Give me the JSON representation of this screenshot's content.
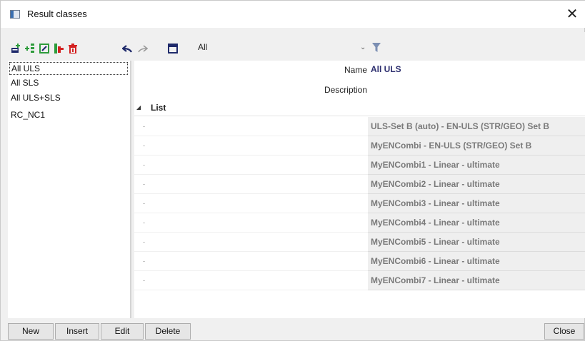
{
  "window": {
    "title": "Result classes"
  },
  "toolbar": {
    "icons": [
      "new-class-icon",
      "insert-class-icon",
      "edit-class-icon",
      "copy-class-icon",
      "delete-class-icon",
      "undo-icon",
      "redo-icon",
      "window-icon"
    ],
    "filter_value": "All"
  },
  "result_classes": [
    "All ULS",
    "All SLS",
    "All ULS+SLS",
    "RC_NC1"
  ],
  "properties": {
    "name_label": "Name",
    "name_value": "All ULS",
    "description_label": "Description",
    "description_value": "",
    "list_section": "List",
    "list_items": [
      "ULS-Set B (auto) - EN-ULS (STR/GEO) Set B",
      "MyENCombi - EN-ULS (STR/GEO) Set B",
      "MyENCombi1 - Linear - ultimate",
      "MyENCombi2 - Linear - ultimate",
      "MyENCombi3 - Linear - ultimate",
      "MyENCombi4 - Linear - ultimate",
      "MyENCombi5 - Linear - ultimate",
      "MyENCombi6 - Linear - ultimate",
      "MyENCombi7 - Linear - ultimate"
    ]
  },
  "buttons": {
    "new": "New",
    "insert": "Insert",
    "edit": "Edit",
    "delete": "Delete",
    "close": "Close"
  },
  "colors": {
    "accent_green": "#2e9c3c",
    "accent_red": "#d42020",
    "accent_navy": "#1f2a6b",
    "value_text": "#2d2f6f"
  }
}
